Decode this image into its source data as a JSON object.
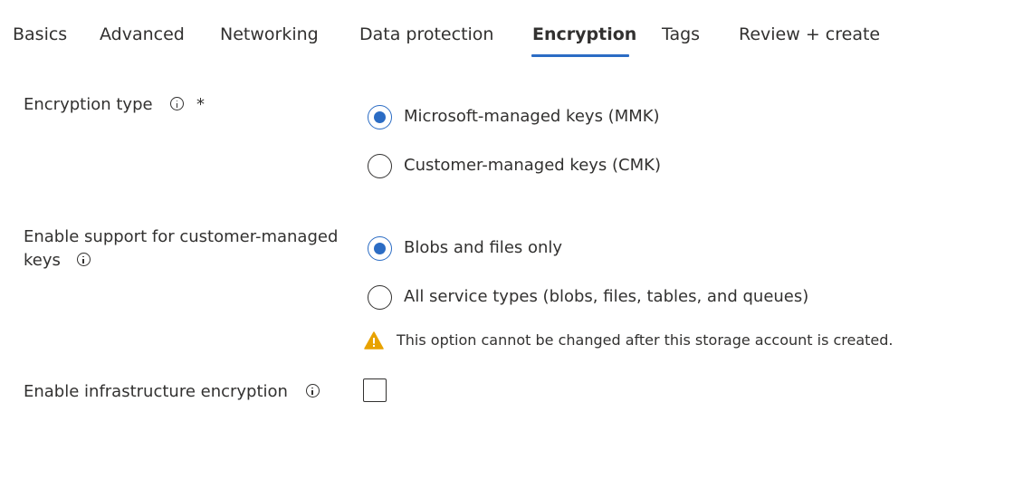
{
  "tabs": [
    {
      "label": "Basics",
      "active": false
    },
    {
      "label": "Advanced",
      "active": false
    },
    {
      "label": "Networking",
      "active": false
    },
    {
      "label": "Data protection",
      "active": false
    },
    {
      "label": "Encryption",
      "active": true
    },
    {
      "label": "Tags",
      "active": false
    },
    {
      "label": "Review + create",
      "active": false
    }
  ],
  "encryption_type": {
    "label": "Encryption type",
    "required_marker": "*",
    "options": [
      {
        "label": "Microsoft-managed keys (MMK)",
        "selected": true
      },
      {
        "label": "Customer-managed keys (CMK)",
        "selected": false
      }
    ]
  },
  "cmk_support": {
    "label_line1": "Enable support for customer-managed",
    "label_line2": "keys",
    "options": [
      {
        "label": "Blobs and files only",
        "selected": true
      },
      {
        "label": "All service types (blobs, files, tables, and queues)",
        "selected": false
      }
    ],
    "warning": "This option cannot be changed after this storage account is created."
  },
  "infrastructure_encryption": {
    "label": "Enable infrastructure encryption",
    "checked": false
  },
  "colors": {
    "accent": "#2b6cc4",
    "text": "#323130",
    "warning": "#e8a200"
  }
}
